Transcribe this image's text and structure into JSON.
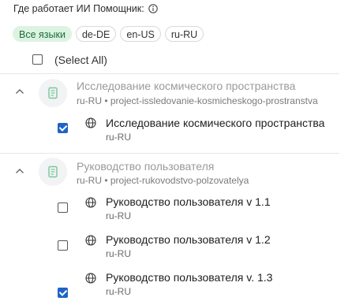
{
  "header": {
    "label": "Где работает ИИ Помощник:",
    "info_icon": "info-icon"
  },
  "chips": [
    {
      "label": "Все языки",
      "active": true
    },
    {
      "label": "de-DE",
      "active": false
    },
    {
      "label": "en-US",
      "active": false
    },
    {
      "label": "ru-RU",
      "active": false
    }
  ],
  "select_all": {
    "label": "(Select All)",
    "checked": false
  },
  "projects": [
    {
      "title": "Исследование космического пространства",
      "subtitle": "ru-RU • project-issledovanie-kosmicheskogo-prostranstva",
      "expanded": true,
      "items": [
        {
          "title": "Исследование космического пространства",
          "locale": "ru-RU",
          "checked": true
        }
      ]
    },
    {
      "title": "Руководство пользователя",
      "subtitle": "ru-RU • project-rukovodstvo-polzovatelya",
      "expanded": true,
      "items": [
        {
          "title": "Руководство пользователя v 1.1",
          "locale": "ru-RU",
          "checked": false
        },
        {
          "title": "Руководство пользователя v 1.2",
          "locale": "ru-RU",
          "checked": false
        },
        {
          "title": "Руководство пользователя v. 1.3",
          "locale": "ru-RU",
          "checked": true
        }
      ]
    }
  ],
  "colors": {
    "accent": "#1f63c6",
    "chip_active_bg": "#dcf3e2",
    "chip_active_text": "#1f6b3a"
  }
}
